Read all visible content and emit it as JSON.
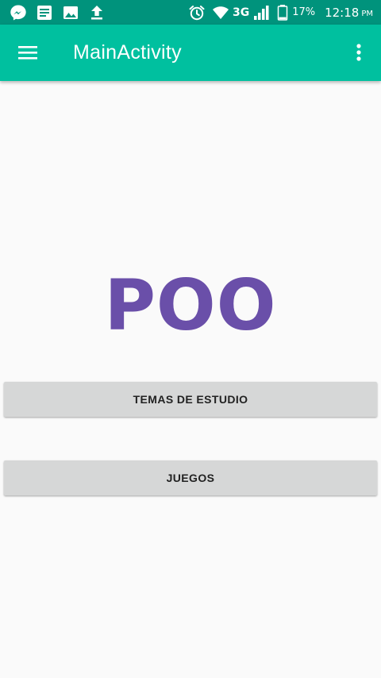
{
  "status_bar": {
    "left_icons": [
      "messenger-icon",
      "notes-icon",
      "image-icon",
      "upload-icon"
    ],
    "network": "3G",
    "battery_percent": "17%",
    "time": "12:18",
    "ampm": "PM"
  },
  "app_bar": {
    "title": "MainActivity",
    "menu_icon": "hamburger-menu-icon",
    "overflow_icon": "more-vert-icon"
  },
  "main": {
    "title": "POO",
    "buttons": [
      {
        "label": "TEMAS DE ESTUDIO"
      },
      {
        "label": "JUEGOS"
      }
    ]
  },
  "colors": {
    "status_bar": "#00937c",
    "app_bar": "#00c09f",
    "accent_title": "#6a4fa9",
    "button_bg": "#d6d7d7",
    "background": "#fafafa"
  }
}
